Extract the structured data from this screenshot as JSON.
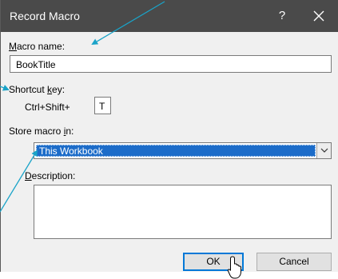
{
  "window": {
    "title": "Record Macro",
    "help_label": "?",
    "close_icon": "close-icon"
  },
  "macro_name": {
    "label_mnemonic": "M",
    "label_rest": "acro name:",
    "value": "BookTitle"
  },
  "shortcut": {
    "label_prefix": "Shortcut ",
    "label_mnemonic": "k",
    "label_rest": "ey:",
    "modifier_text": "Ctrl+Shift+",
    "key_value": "T"
  },
  "store_in": {
    "label_prefix": "Store macro ",
    "label_mnemonic": "i",
    "label_rest": "n:",
    "selected": "This Workbook"
  },
  "description": {
    "label_mnemonic": "D",
    "label_rest": "escription:",
    "value": ""
  },
  "buttons": {
    "ok_label": "OK",
    "cancel_label": "Cancel"
  },
  "colors": {
    "titlebar": "#4a4a4a",
    "selection": "#1c6cc9",
    "callout_arrow": "#1aa3c8"
  }
}
